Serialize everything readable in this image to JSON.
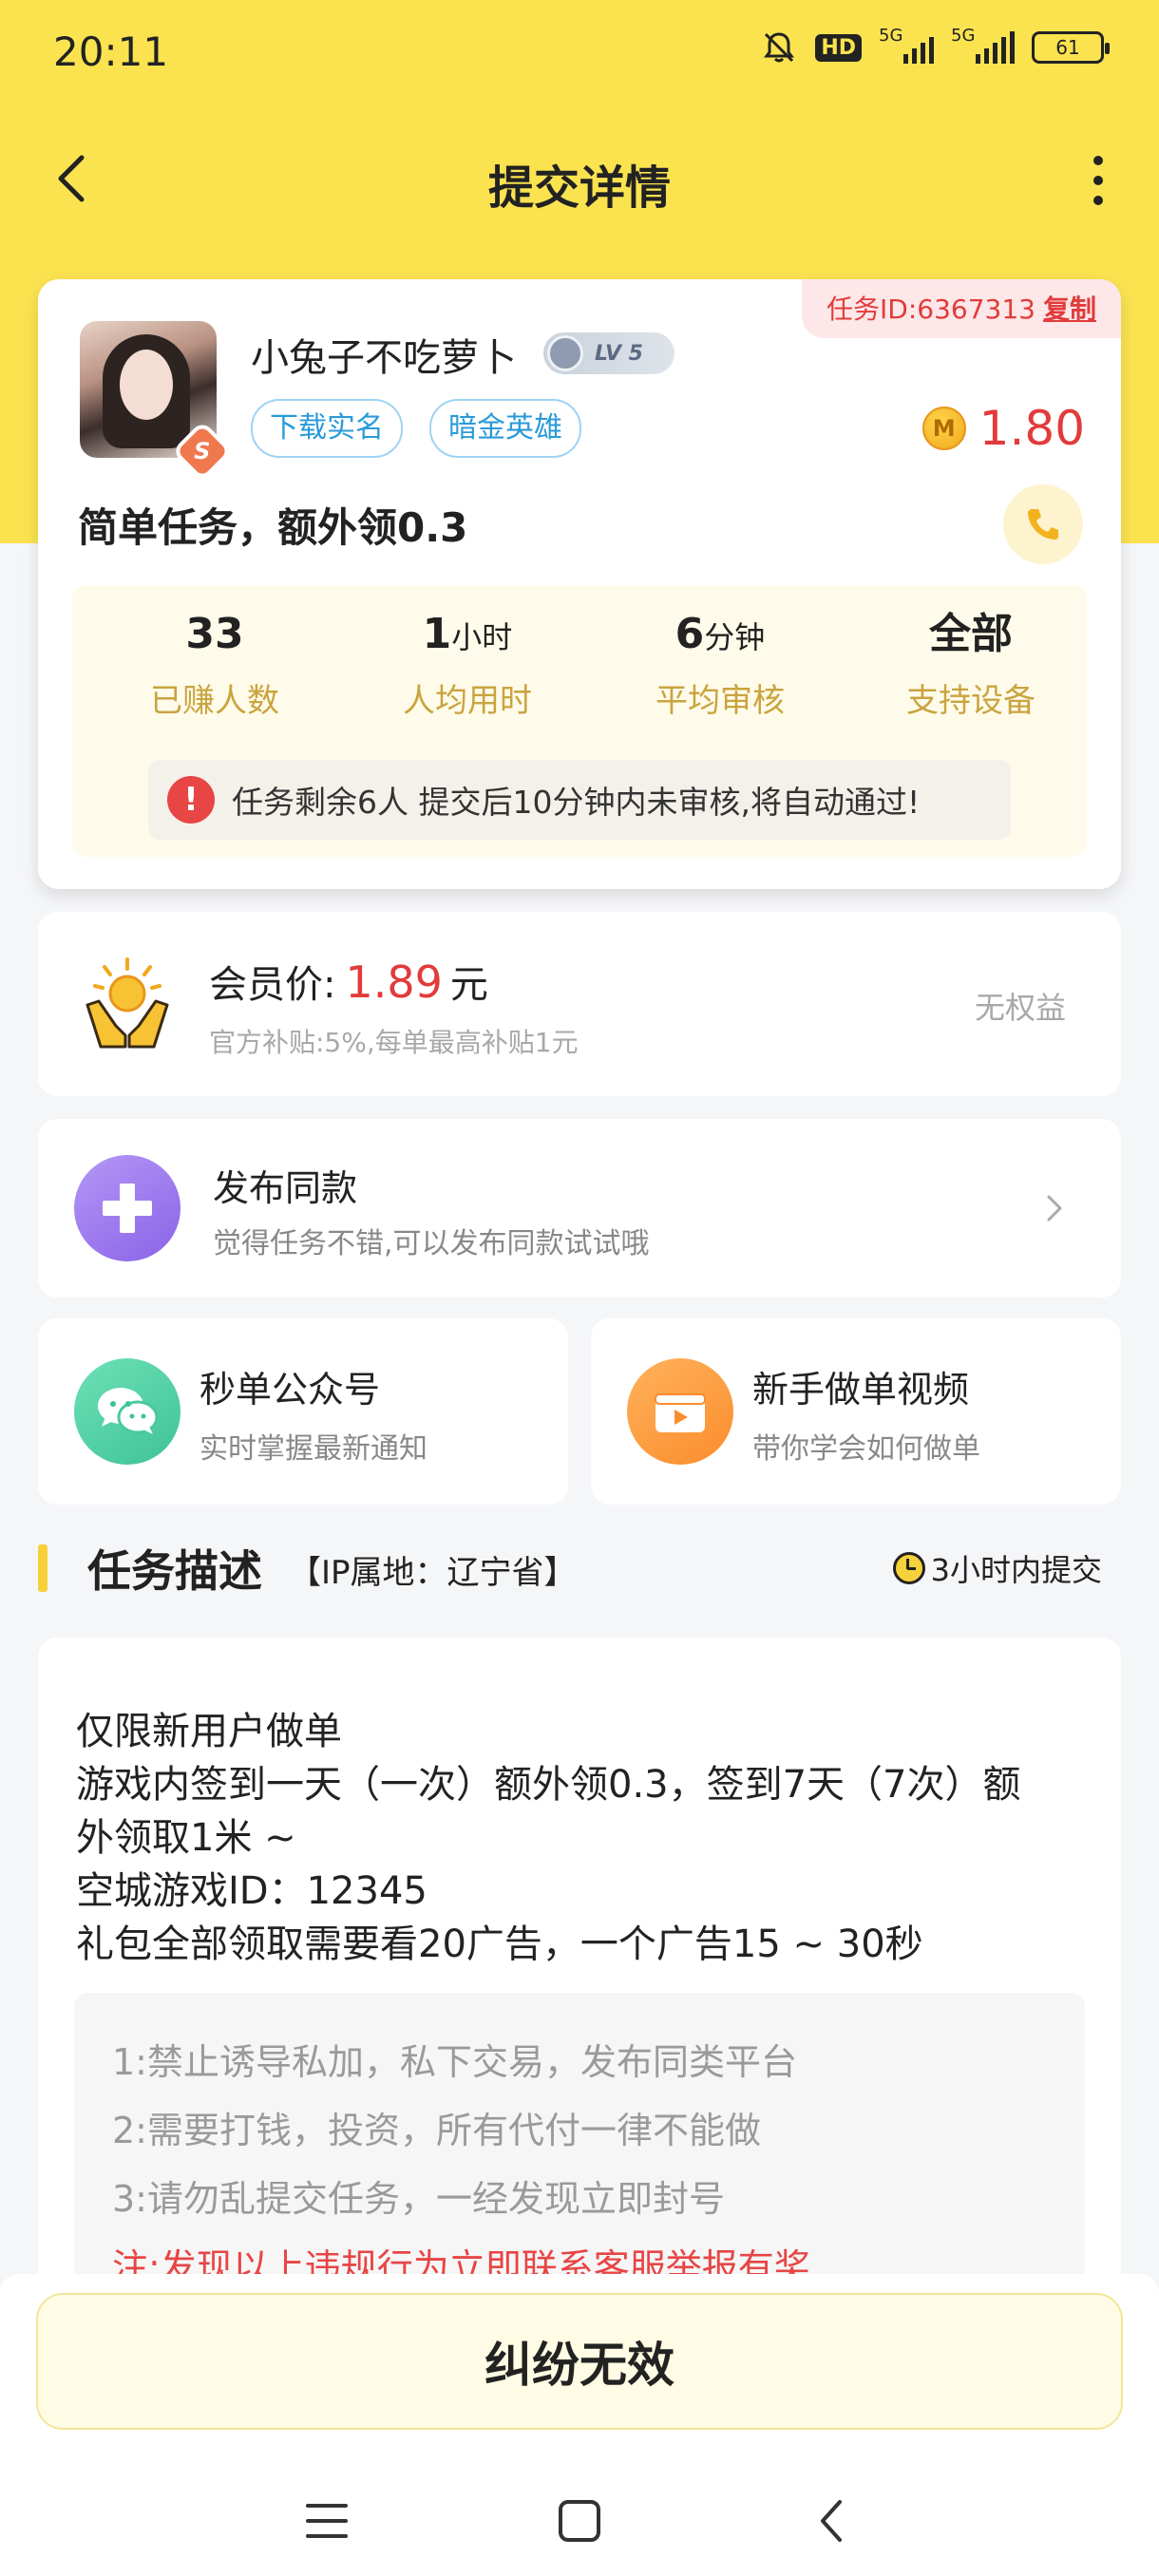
{
  "status": {
    "time": "20:11",
    "hd": "HD",
    "net1": "5G",
    "net2": "5G",
    "battery": "61"
  },
  "header": {
    "title": "提交详情"
  },
  "task": {
    "id_label": "任务ID:6367313",
    "copy_label": "复制",
    "username": "小兔子不吃萝卜",
    "level": "LV 5",
    "avatar_badge": "S",
    "tags": [
      "下载实名",
      "暗金英雄"
    ],
    "coin_symbol": "M",
    "reward": "1.80",
    "title": "简单任务，额外领0.3",
    "stats": [
      {
        "value": "33",
        "unit": "",
        "label": "已赚人数"
      },
      {
        "value": "1",
        "unit": "小时",
        "label": "人均用时"
      },
      {
        "value": "6",
        "unit": "分钟",
        "label": "平均审核"
      },
      {
        "value": "全部",
        "unit": "",
        "label": "支持设备"
      }
    ],
    "notice": "任务剩余6人  提交后10分钟内未审核,将自动通过!"
  },
  "member": {
    "prefix": "会员价:",
    "price": "1.89",
    "unit": "元",
    "sub": "官方补贴:5%,每单最高补贴1元",
    "right": "无权益"
  },
  "publish": {
    "title": "发布同款",
    "sub": "觉得任务不错,可以发布同款试试哦"
  },
  "wechat": {
    "title": "秒单公众号",
    "sub": "实时掌握最新通知"
  },
  "video": {
    "title": "新手做单视频",
    "sub": "带你学会如何做单"
  },
  "section": {
    "title": "任务描述",
    "ip": "【IP属地：辽宁省】",
    "time": "3小时内提交"
  },
  "description": {
    "lines": [
      "仅限新用户做单",
      "游戏内签到一天（一次）额外领0.3，签到7天（7次）额",
      "外领取1米 ~",
      "空城游戏ID：12345",
      "礼包全部领取需要看20广告，一个广告15 ~ 30秒"
    ],
    "rules": [
      "1:禁止诱导私加，私下交易，发布同类平台",
      "2:需要打钱，投资，所有代付一律不能做",
      "3:请勿乱提交任务，一经发现立即封号",
      "注:发现以上违规行为立即联系客服举报有奖"
    ]
  },
  "bottom": {
    "dispute_label": "纠纷无效"
  },
  "colors": {
    "brand_yellow": "#fbe350",
    "price_red": "#e23b3b",
    "tag_blue": "#2a9ad8",
    "stat_gold": "#c9a43f"
  }
}
